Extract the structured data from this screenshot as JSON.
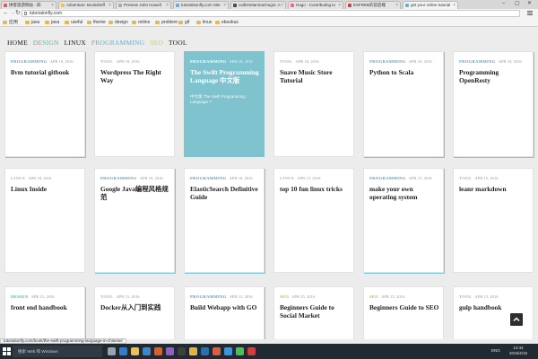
{
  "browser": {
    "tabs": [
      {
        "label": "拼客旅游网站 - 四",
        "color": "#e8594b"
      },
      {
        "label": "Adventure: Booksheff",
        "color": "#f0c24a"
      },
      {
        "label": "Preview John Howell",
        "color": "#aaaaaa"
      },
      {
        "label": "tutorialsonfly.com Site",
        "color": "#6aa9e0"
      },
      {
        "label": "caifeinetanmachugio: A",
        "color": "#4a4a4a"
      },
      {
        "label": "Hugo - Contributing to",
        "color": "#ff5c8d"
      },
      {
        "label": "ESFREB的前后端",
        "color": "#cf3c3c"
      },
      {
        "label": "get your online tutorial",
        "color": "#5cb6d0"
      }
    ],
    "back_icon": "back-arrow-icon",
    "forward_icon": "forward-arrow-icon",
    "reload_icon": "reload-icon",
    "url": "tutorialonfly.com",
    "bookmarks": [
      "应用",
      "java",
      "java",
      "useful",
      "theme",
      "design",
      "online",
      "problem",
      "gif",
      "linux",
      "ebookus"
    ],
    "status_url": "tutorialonfly.com/book/the-swift-programming-language-in-chinese/"
  },
  "site": {
    "nav": [
      {
        "label": "HOME",
        "color": "#222222"
      },
      {
        "label": "DESIGN",
        "color": "#5cc08a"
      },
      {
        "label": "LINUX",
        "color": "#222222"
      },
      {
        "label": "PROGRAMMING",
        "color": "#5bb7d6"
      },
      {
        "label": "SEO",
        "color": "#bfd84c"
      },
      {
        "label": "TOOL",
        "color": "#222222"
      }
    ],
    "category_colors": {
      "PROGRAMMING": "#4aa8d0",
      "TOOL": "#b0b0b0",
      "LINUX": "#b0b0b0",
      "DESIGN": "#4cc18a",
      "SEO": "#a8c93a"
    },
    "cards": [
      {
        "category": "PROGRAMMING",
        "date": "APR 18, 2016",
        "title": "llvm tutorial gitbook",
        "subtitle": ""
      },
      {
        "category": "TOOL",
        "date": "APR 18, 2016",
        "title": "Wordpress The Right Way",
        "subtitle": ""
      },
      {
        "category": "PROGRAMMING",
        "date": "APR 18, 2016",
        "title": "The Swift Programming Language 中文版",
        "subtitle": "中文版 The Swift Programming Language ?"
      },
      {
        "category": "TOOL",
        "date": "APR 18, 2016",
        "title": "Suave Music Store Tutorial",
        "subtitle": ""
      },
      {
        "category": "PROGRAMMING",
        "date": "APR 18, 2016",
        "title": "Python to Scala",
        "subtitle": ""
      },
      {
        "category": "PROGRAMMING",
        "date": "APR 18, 2016",
        "title": "Programming OpenResty",
        "subtitle": ""
      },
      {
        "category": "LINUX",
        "date": "APR 18, 2016",
        "title": "Linux Inside",
        "subtitle": ""
      },
      {
        "category": "PROGRAMMING",
        "date": "APR 18, 2016",
        "title": "Google Java编程风格规范",
        "subtitle": ""
      },
      {
        "category": "PROGRAMMING",
        "date": "APR 18, 2016",
        "title": "ElasticSearch Definitive Guide",
        "subtitle": ""
      },
      {
        "category": "LINUX",
        "date": "APR 15, 2016",
        "title": "top 10 fun linux tricks",
        "subtitle": ""
      },
      {
        "category": "PROGRAMMING",
        "date": "APR 15, 2016",
        "title": "make your own operating system",
        "subtitle": ""
      },
      {
        "category": "TOOL",
        "date": "APR 15, 2016",
        "title": "leanr markdown",
        "subtitle": ""
      },
      {
        "category": "DESIGN",
        "date": "APR 15, 2016",
        "title": "front end handbook",
        "subtitle": ""
      },
      {
        "category": "TOOL",
        "date": "APR 15, 2016",
        "title": "Docker从入门到实践",
        "subtitle": ""
      },
      {
        "category": "PROGRAMMING",
        "date": "APR 15, 2016",
        "title": "Build Webapp with GO",
        "subtitle": ""
      },
      {
        "category": "SEO",
        "date": "APR 15, 2016",
        "title": "Beginners Guide to Social Market",
        "subtitle": ""
      },
      {
        "category": "SEO",
        "date": "APR 15, 2016",
        "title": "Beginners Guide to SEO",
        "subtitle": ""
      },
      {
        "category": "TOOL",
        "date": "APR 15, 2016",
        "title": "gulp handbook",
        "subtitle": ""
      }
    ],
    "featured_index": 2,
    "scroll_top_icon": "chevron-up-icon"
  },
  "taskbar": {
    "search_placeholder": "搜索 Web 和 Windows",
    "start_icon": "windows-start-icon",
    "apps": [
      {
        "icon": "task-view-icon",
        "color": "#9aa3ab"
      },
      {
        "icon": "edge-browser-icon",
        "color": "#2d7fd3"
      },
      {
        "icon": "file-explorer-icon",
        "color": "#e9c25a"
      },
      {
        "icon": "store-icon",
        "color": "#3a86d1"
      },
      {
        "icon": "java-icon",
        "color": "#d8602f"
      },
      {
        "icon": "visual-studio-icon",
        "color": "#8f5fc8"
      },
      {
        "icon": "terminal-icon",
        "color": "#3f3f3f"
      },
      {
        "icon": "chrome-icon",
        "color": "#e0b43d"
      },
      {
        "icon": "photoshop-icon",
        "color": "#2a6fb0"
      },
      {
        "icon": "git-icon",
        "color": "#e25b3a"
      },
      {
        "icon": "vscode-icon",
        "color": "#3a97dd"
      },
      {
        "icon": "wechat-icon",
        "color": "#4cbf56"
      },
      {
        "icon": "music-icon",
        "color": "#d63c3c"
      }
    ],
    "lang": "ENG",
    "time": "14:44",
    "date": "2016/4/15"
  }
}
